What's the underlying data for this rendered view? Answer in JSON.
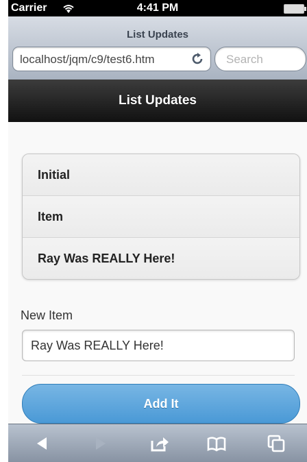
{
  "status_bar": {
    "carrier": "Carrier",
    "time": "4:41 PM",
    "wifi_icon": "wifi-icon",
    "battery_icon": "battery-icon"
  },
  "browser": {
    "page_title": "List Updates",
    "url": "localhost/jqm/c9/test6.htm",
    "reload_icon": "reload-icon",
    "search_placeholder": "Search"
  },
  "header": {
    "title": "List Updates"
  },
  "list": {
    "items": [
      "Initial",
      "Item",
      "Ray Was REALLY Here!"
    ]
  },
  "form": {
    "label": "New Item",
    "input_value": "Ray Was REALLY Here!",
    "button_label": "Add It"
  },
  "toolbar": {
    "icons": [
      "back-icon",
      "forward-icon",
      "share-icon",
      "bookmarks-icon",
      "tabs-icon"
    ]
  }
}
